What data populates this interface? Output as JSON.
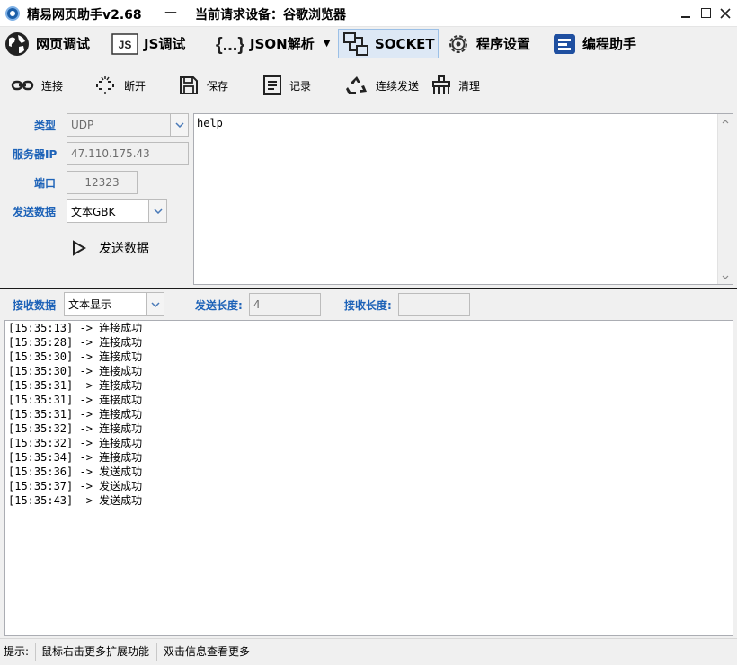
{
  "window": {
    "title": "精易网页助手v2.68",
    "dash": "—",
    "device": "当前请求设备：谷歌浏览器"
  },
  "main_tabs": [
    {
      "label": "网页调试",
      "icon": "globe-icon"
    },
    {
      "label": "JS调试",
      "icon": "js-icon"
    },
    {
      "label": "JSON解析",
      "icon": "braces-icon"
    },
    {
      "label": "SOCKET",
      "icon": "network-icon",
      "active": true
    },
    {
      "label": "程序设置",
      "icon": "gear-icon"
    },
    {
      "label": "编程助手",
      "icon": "code-helper-icon"
    }
  ],
  "toolbar": {
    "connect": "连接",
    "disconnect": "断开",
    "save": "保存",
    "record": "记录",
    "continuous_send": "连续发送",
    "clear": "清理"
  },
  "form": {
    "type_label": "类型",
    "type_value": "UDP",
    "server_ip_label": "服务器IP",
    "server_ip_value": "47.110.175.43",
    "port_label": "端口",
    "port_value": "12323",
    "send_data_label": "发送数据",
    "send_data_value": "文本GBK",
    "send_button": "发送数据"
  },
  "send_text": "help",
  "receive": {
    "label": "接收数据",
    "mode": "文本显示",
    "send_length_label": "发送长度:",
    "send_length_value": "4",
    "recv_length_label": "接收长度:",
    "recv_length_value": ""
  },
  "log": [
    "[15:35:13] -> 连接成功",
    "[15:35:28] -> 连接成功",
    "[15:35:30] -> 连接成功",
    "[15:35:30] -> 连接成功",
    "[15:35:31] -> 连接成功",
    "[15:35:31] -> 连接成功",
    "[15:35:31] -> 连接成功",
    "[15:35:32] -> 连接成功",
    "[15:35:32] -> 连接成功",
    "[15:35:34] -> 连接成功",
    "[15:35:36] -> 发送成功",
    "[15:35:37] -> 发送成功",
    "[15:35:43] -> 发送成功"
  ],
  "status": {
    "tip_label": "提示:",
    "tip1": "鼠标右击更多扩展功能",
    "tip2": "双击信息查看更多"
  },
  "colors": {
    "label_blue": "#1e63b8",
    "active_tab_bg": "#dde8f5"
  }
}
